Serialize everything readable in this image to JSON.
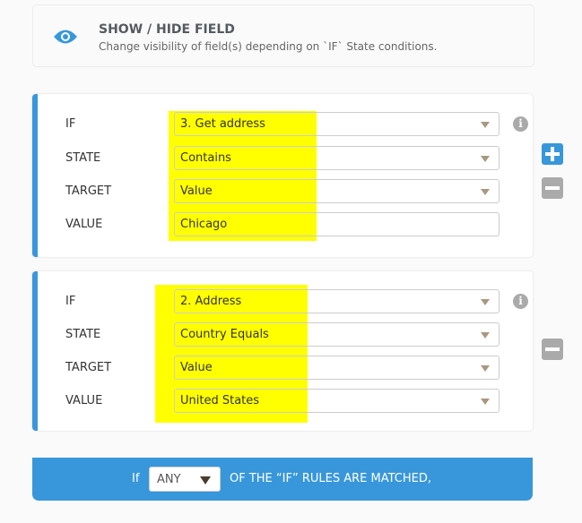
{
  "header": {
    "icon": "eye-icon",
    "title": "SHOW / HIDE FIELD",
    "subtitle": "Change visibility of field(s) depending on `IF` State conditions."
  },
  "conditions": [
    {
      "labels": [
        "IF",
        "STATE",
        "TARGET",
        "VALUE"
      ],
      "if": "3. Get address",
      "state": "Contains",
      "target": "Value",
      "value": "Chicago"
    },
    {
      "labels": [
        "IF",
        "STATE",
        "TARGET",
        "VALUE"
      ],
      "if": "2. Address",
      "state": "Country Equals",
      "target": "Value",
      "value": "United States"
    }
  ],
  "footer": {
    "prefix": "If",
    "match": "ANY",
    "suffix": "OF THE “IF” RULES ARE MATCHED,"
  },
  "colors": {
    "accent": "#3897db",
    "highlight": "#ffff00",
    "muted_button": "#aaaaaa"
  }
}
